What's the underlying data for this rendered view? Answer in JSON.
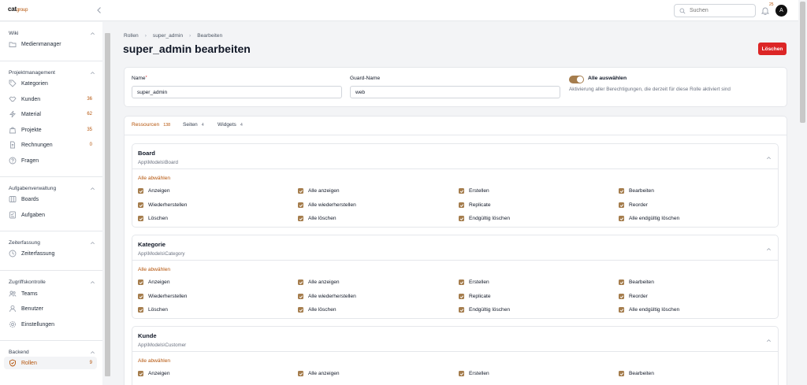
{
  "header": {
    "logo_main": "cat",
    "logo_sub": "group",
    "search_placeholder": "Suchen",
    "notif_count": "25",
    "avatar_initial": "A"
  },
  "sidebar": {
    "groups": [
      {
        "label": "Wiki",
        "items": [
          {
            "label": "Medienmanager",
            "icon": "folder-icon",
            "count": ""
          }
        ]
      },
      {
        "label": "Projektmanagement",
        "items": [
          {
            "label": "Kategorien",
            "icon": "tag-icon",
            "count": ""
          },
          {
            "label": "Kunden",
            "icon": "handshake-icon",
            "count": "36"
          },
          {
            "label": "Material",
            "icon": "bolt-icon",
            "count": "62"
          },
          {
            "label": "Projekte",
            "icon": "bag-icon",
            "count": "35"
          },
          {
            "label": "Rechnungen",
            "icon": "document-icon",
            "count": "0"
          },
          {
            "label": "Fragen",
            "icon": "question-icon",
            "count": ""
          }
        ]
      },
      {
        "label": "Aufgabenverwaltung",
        "items": [
          {
            "label": "Boards",
            "icon": "columns-icon",
            "count": ""
          },
          {
            "label": "Aufgaben",
            "icon": "checklist-icon",
            "count": ""
          }
        ]
      },
      {
        "label": "Zeiterfassung",
        "items": [
          {
            "label": "Zeiterfassung",
            "icon": "clock-icon",
            "count": ""
          }
        ]
      },
      {
        "label": "Zugriffskontrolle",
        "items": [
          {
            "label": "Teams",
            "icon": "users-icon",
            "count": ""
          },
          {
            "label": "Benutzer",
            "icon": "user-icon",
            "count": ""
          },
          {
            "label": "Einstellungen",
            "icon": "gear-icon",
            "count": ""
          }
        ]
      },
      {
        "label": "Backend",
        "items": [
          {
            "label": "Rollen",
            "icon": "shield-icon",
            "count": "9",
            "active": true
          }
        ]
      }
    ]
  },
  "breadcrumb": [
    "Rollen",
    "super_admin",
    "Bearbeiten"
  ],
  "page_title": "super_admin bearbeiten",
  "delete_label": "Löschen",
  "form": {
    "name_label": "Name",
    "name_required": "*",
    "name_value": "super_admin",
    "guard_label": "Guard-Name",
    "guard_value": "web",
    "toggle_label": "Alle auswählen",
    "toggle_desc": "Aktivierung aller Berechtigungen, die derzeit für diese Rolle aktiviert sind"
  },
  "tabs": [
    {
      "label": "Ressourcen",
      "count": "138",
      "active": true
    },
    {
      "label": "Seiten",
      "count": "4"
    },
    {
      "label": "Widgets",
      "count": "4"
    }
  ],
  "deselect_label": "Alle abwählen",
  "permissions": [
    "Anzeigen",
    "Alle anzeigen",
    "Erstellen",
    "Bearbeiten",
    "Wiederherstellen",
    "Alle wiederherstellen",
    "Replicate",
    "Reorder",
    "Löschen",
    "Alle löschen",
    "Endgültig löschen",
    "Alle endgültig löschen"
  ],
  "resources": [
    {
      "title": "Board",
      "model": "App\\Models\\Board"
    },
    {
      "title": "Kategorie",
      "model": "App\\Models\\Category"
    },
    {
      "title": "Kunde",
      "model": "App\\Models\\Customer"
    }
  ]
}
